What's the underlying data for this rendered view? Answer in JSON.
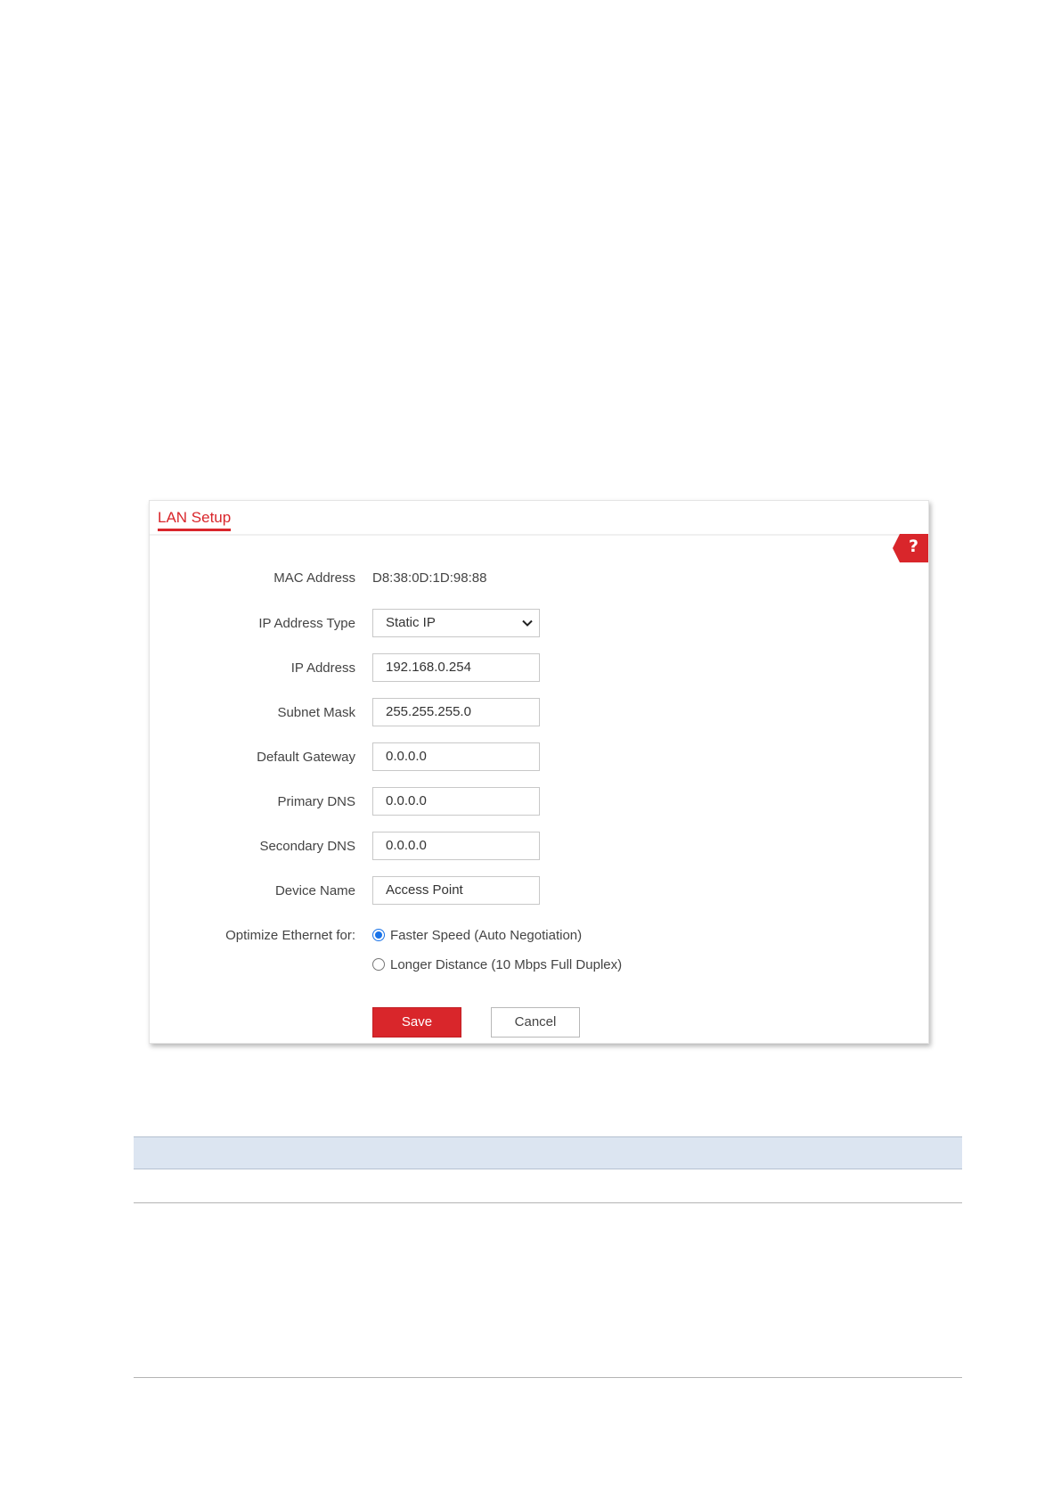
{
  "panel": {
    "title": "LAN Setup",
    "help_icon": "question-mark-icon",
    "help_label": "?"
  },
  "form": {
    "mac_address": {
      "label": "MAC Address",
      "value": "D8:38:0D:1D:98:88"
    },
    "ip_address_type": {
      "label": "IP Address Type",
      "value": "Static IP"
    },
    "ip_address": {
      "label": "IP Address",
      "value": "192.168.0.254"
    },
    "subnet_mask": {
      "label": "Subnet Mask",
      "value": "255.255.255.0"
    },
    "default_gateway": {
      "label": "Default Gateway",
      "value": "0.0.0.0"
    },
    "primary_dns": {
      "label": "Primary DNS",
      "value": "0.0.0.0"
    },
    "secondary_dns": {
      "label": "Secondary DNS",
      "value": "0.0.0.0"
    },
    "device_name": {
      "label": "Device Name",
      "value": "Access Point"
    },
    "optimize_ethernet": {
      "label": "Optimize Ethernet for:",
      "options": [
        {
          "label": "Faster Speed (Auto Negotiation)",
          "checked": true
        },
        {
          "label": "Longer Distance (10 Mbps Full Duplex)",
          "checked": false
        }
      ]
    }
  },
  "buttons": {
    "save": "Save",
    "cancel": "Cancel"
  },
  "colors": {
    "accent": "#d9262b",
    "radio_selected": "#1a73e8",
    "table_header_bg": "#dce5f1"
  }
}
